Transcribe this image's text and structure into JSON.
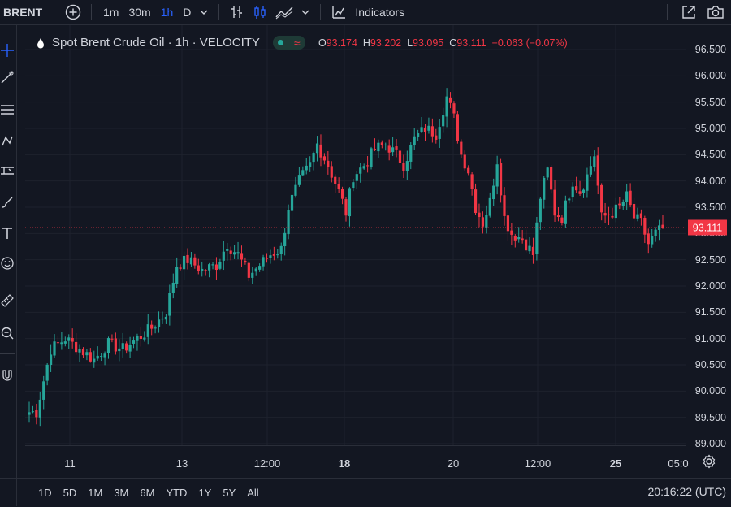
{
  "toolbar": {
    "symbol": "BRENT",
    "intervals": [
      "1m",
      "30m",
      "1h",
      "D"
    ],
    "active_interval": "1h",
    "indicators_label": "Indicators"
  },
  "legend": {
    "title": "Spot Brent Crude Oil · 1h · VELOCITY",
    "o_label": "O",
    "o_value": "93.174",
    "h_label": "H",
    "h_value": "93.202",
    "l_label": "L",
    "l_value": "93.095",
    "c_label": "C",
    "c_value": "93.111",
    "change": "−0.063 (−0.07%)"
  },
  "price_axis": {
    "labels": [
      "96.500",
      "96.000",
      "95.500",
      "95.000",
      "94.500",
      "94.000",
      "93.500",
      "93.000",
      "92.500",
      "92.000",
      "91.500",
      "91.000",
      "90.500",
      "90.000",
      "89.500",
      "89.000"
    ],
    "current_price": "93.111"
  },
  "time_axis": {
    "labels": [
      "11",
      "13",
      "12:00",
      "18",
      "20",
      "12:00",
      "25",
      "05:0"
    ]
  },
  "bottom_bar": {
    "ranges": [
      "1D",
      "5D",
      "1M",
      "3M",
      "6M",
      "YTD",
      "1Y",
      "5Y",
      "All"
    ],
    "clock": "20:16:22 (UTC)"
  },
  "colors": {
    "up": "#26a69a",
    "down": "#f23645",
    "background": "#131722",
    "grid": "#1e222d"
  },
  "chart_data": {
    "type": "candlestick",
    "ylim": [
      89.0,
      96.5
    ],
    "current_price": 93.111,
    "close_path": [
      [
        0,
        89.6
      ],
      [
        2,
        89.6
      ],
      [
        6,
        90.8
      ],
      [
        10,
        91.0
      ],
      [
        14,
        90.8
      ],
      [
        18,
        90.6
      ],
      [
        22,
        90.9
      ],
      [
        26,
        90.8
      ],
      [
        30,
        91.0
      ],
      [
        34,
        91.2
      ],
      [
        38,
        91.5
      ],
      [
        41,
        92.4
      ],
      [
        44,
        92.5
      ],
      [
        48,
        92.3
      ],
      [
        52,
        92.4
      ],
      [
        55,
        92.8
      ],
      [
        58,
        92.6
      ],
      [
        61,
        92.2
      ],
      [
        64,
        92.4
      ],
      [
        67,
        92.6
      ],
      [
        70,
        92.7
      ],
      [
        72,
        93.5
      ],
      [
        75,
        94.0
      ],
      [
        78,
        94.3
      ],
      [
        80,
        94.7
      ],
      [
        83,
        94.3
      ],
      [
        86,
        93.8
      ],
      [
        88,
        93.4
      ],
      [
        90,
        94.1
      ],
      [
        93,
        94.3
      ],
      [
        96,
        94.6
      ],
      [
        99,
        94.7
      ],
      [
        102,
        94.5
      ],
      [
        104,
        94.3
      ],
      [
        107,
        94.8
      ],
      [
        110,
        95.0
      ],
      [
        113,
        94.9
      ],
      [
        116,
        95.6
      ],
      [
        118,
        95.2
      ],
      [
        120,
        94.5
      ],
      [
        122,
        94.2
      ],
      [
        124,
        93.5
      ],
      [
        126,
        93.2
      ],
      [
        128,
        93.6
      ],
      [
        130,
        94.4
      ],
      [
        132,
        93.3
      ],
      [
        134,
        93.0
      ],
      [
        137,
        92.9
      ],
      [
        140,
        92.6
      ],
      [
        142,
        93.7
      ],
      [
        144,
        94.2
      ],
      [
        146,
        93.4
      ],
      [
        148,
        93.3
      ],
      [
        151,
        94.0
      ],
      [
        153,
        93.8
      ],
      [
        155,
        94.1
      ],
      [
        157,
        94.5
      ],
      [
        159,
        93.3
      ],
      [
        162,
        93.4
      ],
      [
        164,
        93.5
      ],
      [
        166,
        93.7
      ],
      [
        168,
        93.3
      ],
      [
        170,
        93.2
      ],
      [
        172,
        92.8
      ],
      [
        174,
        93.0
      ],
      [
        176,
        93.1
      ]
    ]
  }
}
